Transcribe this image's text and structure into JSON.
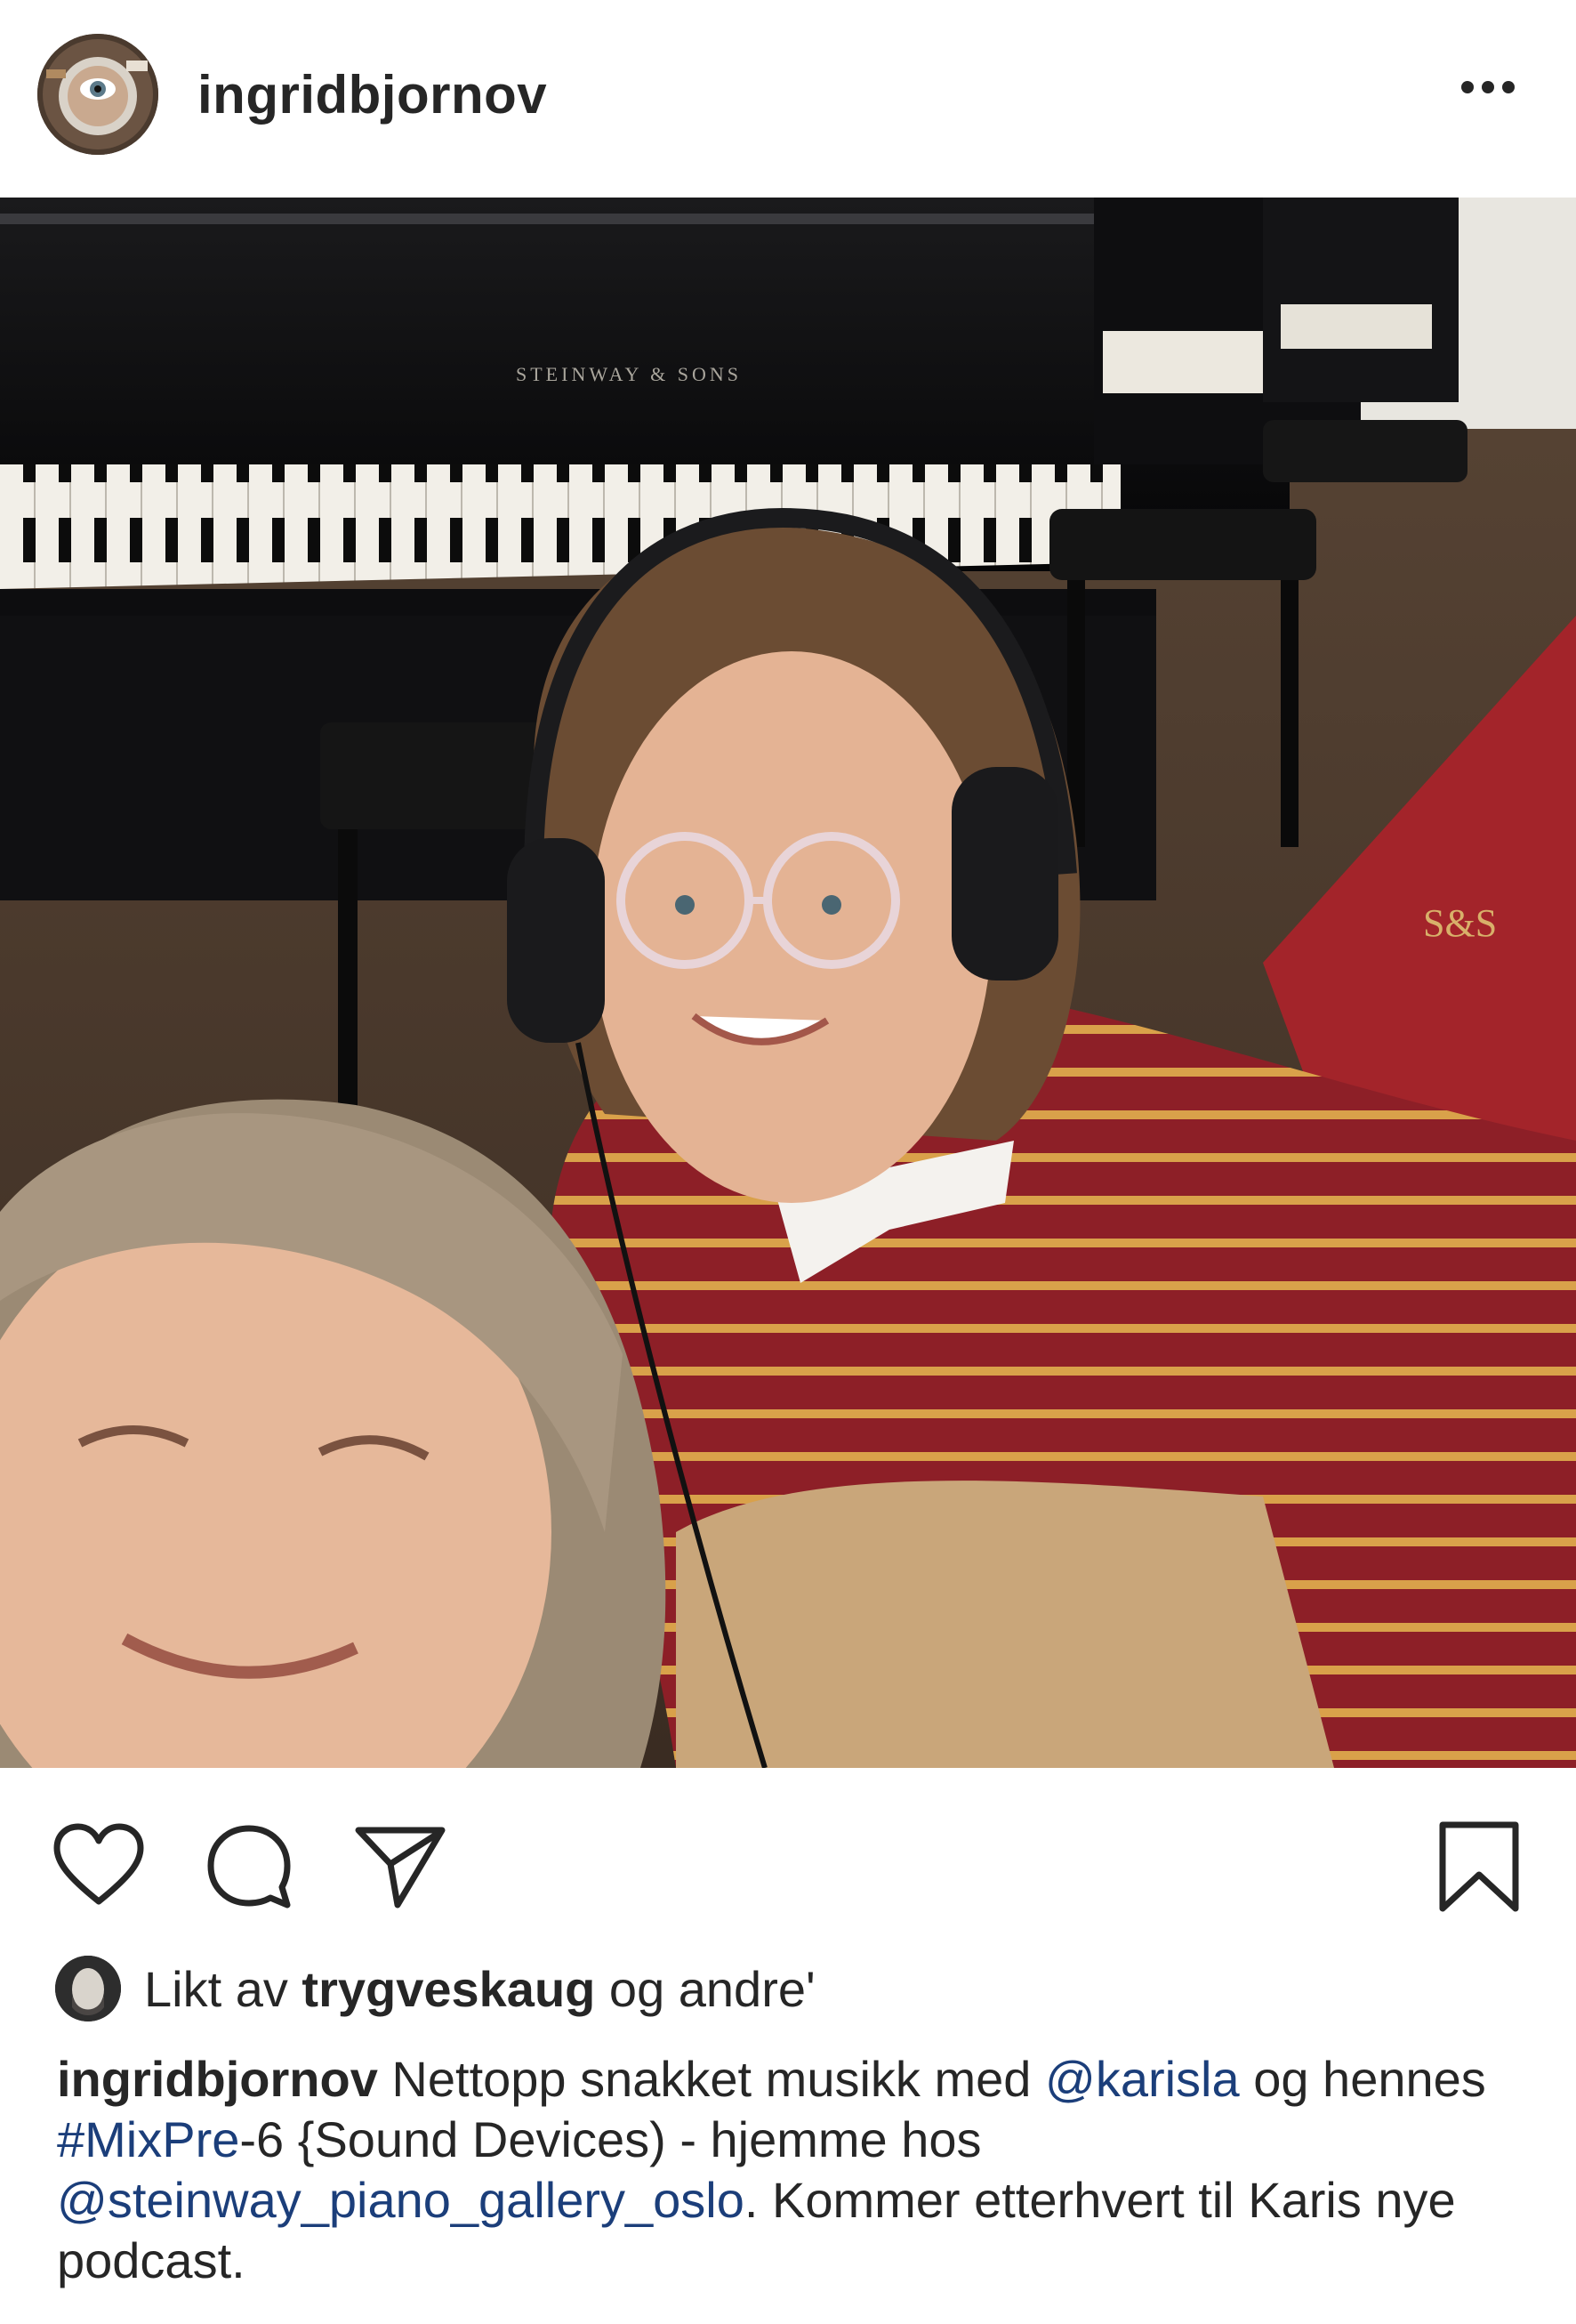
{
  "post": {
    "username": "ingridbjornov",
    "more_icon": "more-horizontal-icon"
  },
  "actions": {
    "like_icon": "heart-icon",
    "comment_icon": "comment-icon",
    "share_icon": "send-icon",
    "save_icon": "bookmark-icon"
  },
  "likes": {
    "prefix": "Likt av",
    "user": "trygveskaug",
    "suffix": "og andre'"
  },
  "caption": {
    "username": "ingridbjornov",
    "part1": "Nettopp snakket musikk med",
    "mention1": "@karisla",
    "part2": "og hennes",
    "hashtag": "#MixPre",
    "part3": "-6 {Sound Devices) - hjemme hos",
    "mention2": "@steinway_piano_gallery_oslo",
    "part4": ". Kommer etterhvert til Karis nye podcast."
  },
  "photo": {
    "brand_text": "STEINWAY & SONS"
  }
}
